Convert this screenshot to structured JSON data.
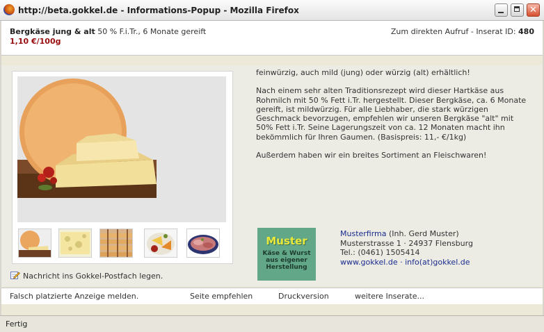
{
  "window": {
    "title": "http://beta.gokkel.de - Informations-Popup - Mozilla Firefox"
  },
  "header": {
    "product_name": "Bergkäse jung & alt",
    "product_details": "50 % F.i.Tr., 6 Monate gereift",
    "price": "1,10 €/100g",
    "direct_call_label": "Zum direkten Aufruf - Inserat ID:",
    "ad_id": "480"
  },
  "description": {
    "paragraphs": [
      "feinwürzig, auch mild (jung) oder würzig (alt) erhältlich!",
      "Nach einem sehr alten Traditionsrezept wird dieser Hartkäse aus Rohmilch mit 50 % Fett i.Tr. hergestellt. Dieser Bergkäse, ca. 6 Monate gereift, ist mildwürzig. Für alle Liebhaber, die stark würzigen Geschmack bevorzugen, empfehlen wir unseren Bergkäse \"alt\" mit 50% Fett i.Tr. Seine Lagerungszeit von ca. 12 Monaten macht ihn bekömmlich für Ihren Gaumen. (Basispreis: 11,- €/1kg)",
      "Außerdem haben wir ein breites Sortiment an Fleischwaren!"
    ]
  },
  "postfach": {
    "label": "Nachricht ins Gokkel-Postfach legen."
  },
  "logo": {
    "title": "Muster",
    "subtitle_line1": "Käse & Wurst",
    "subtitle_line2": "aus eigener",
    "subtitle_line3": "Herstellung",
    "colors": {
      "background": "#62a888",
      "title": "#e9e93a"
    }
  },
  "contact": {
    "firm": "Musterfirma",
    "owner": "(Inh. Gerd Muster)",
    "address": "Musterstrasse 1 · 24937 Flensburg",
    "phone": "Tel.: (0461) 1505414",
    "website": "www.gokkel.de",
    "separator": "·",
    "email": "info(at)gokkel.de"
  },
  "footer": {
    "report": "Falsch platzierte Anzeige melden.",
    "recommend": "Seite empfehlen",
    "print": "Druckversion",
    "more": "weitere Inserate..."
  },
  "status": {
    "text": "Fertig"
  },
  "images": {
    "main": "cheese-wheel-photo",
    "thumbnails": [
      "cheese-wheel-thumb",
      "cheese-holes-thumb",
      "cheese-cellar-thumb",
      "cheese-platter-thumb",
      "meat-platter-thumb"
    ]
  },
  "colors": {
    "price": "#9a0e0e",
    "link": "#1a2c8f"
  }
}
